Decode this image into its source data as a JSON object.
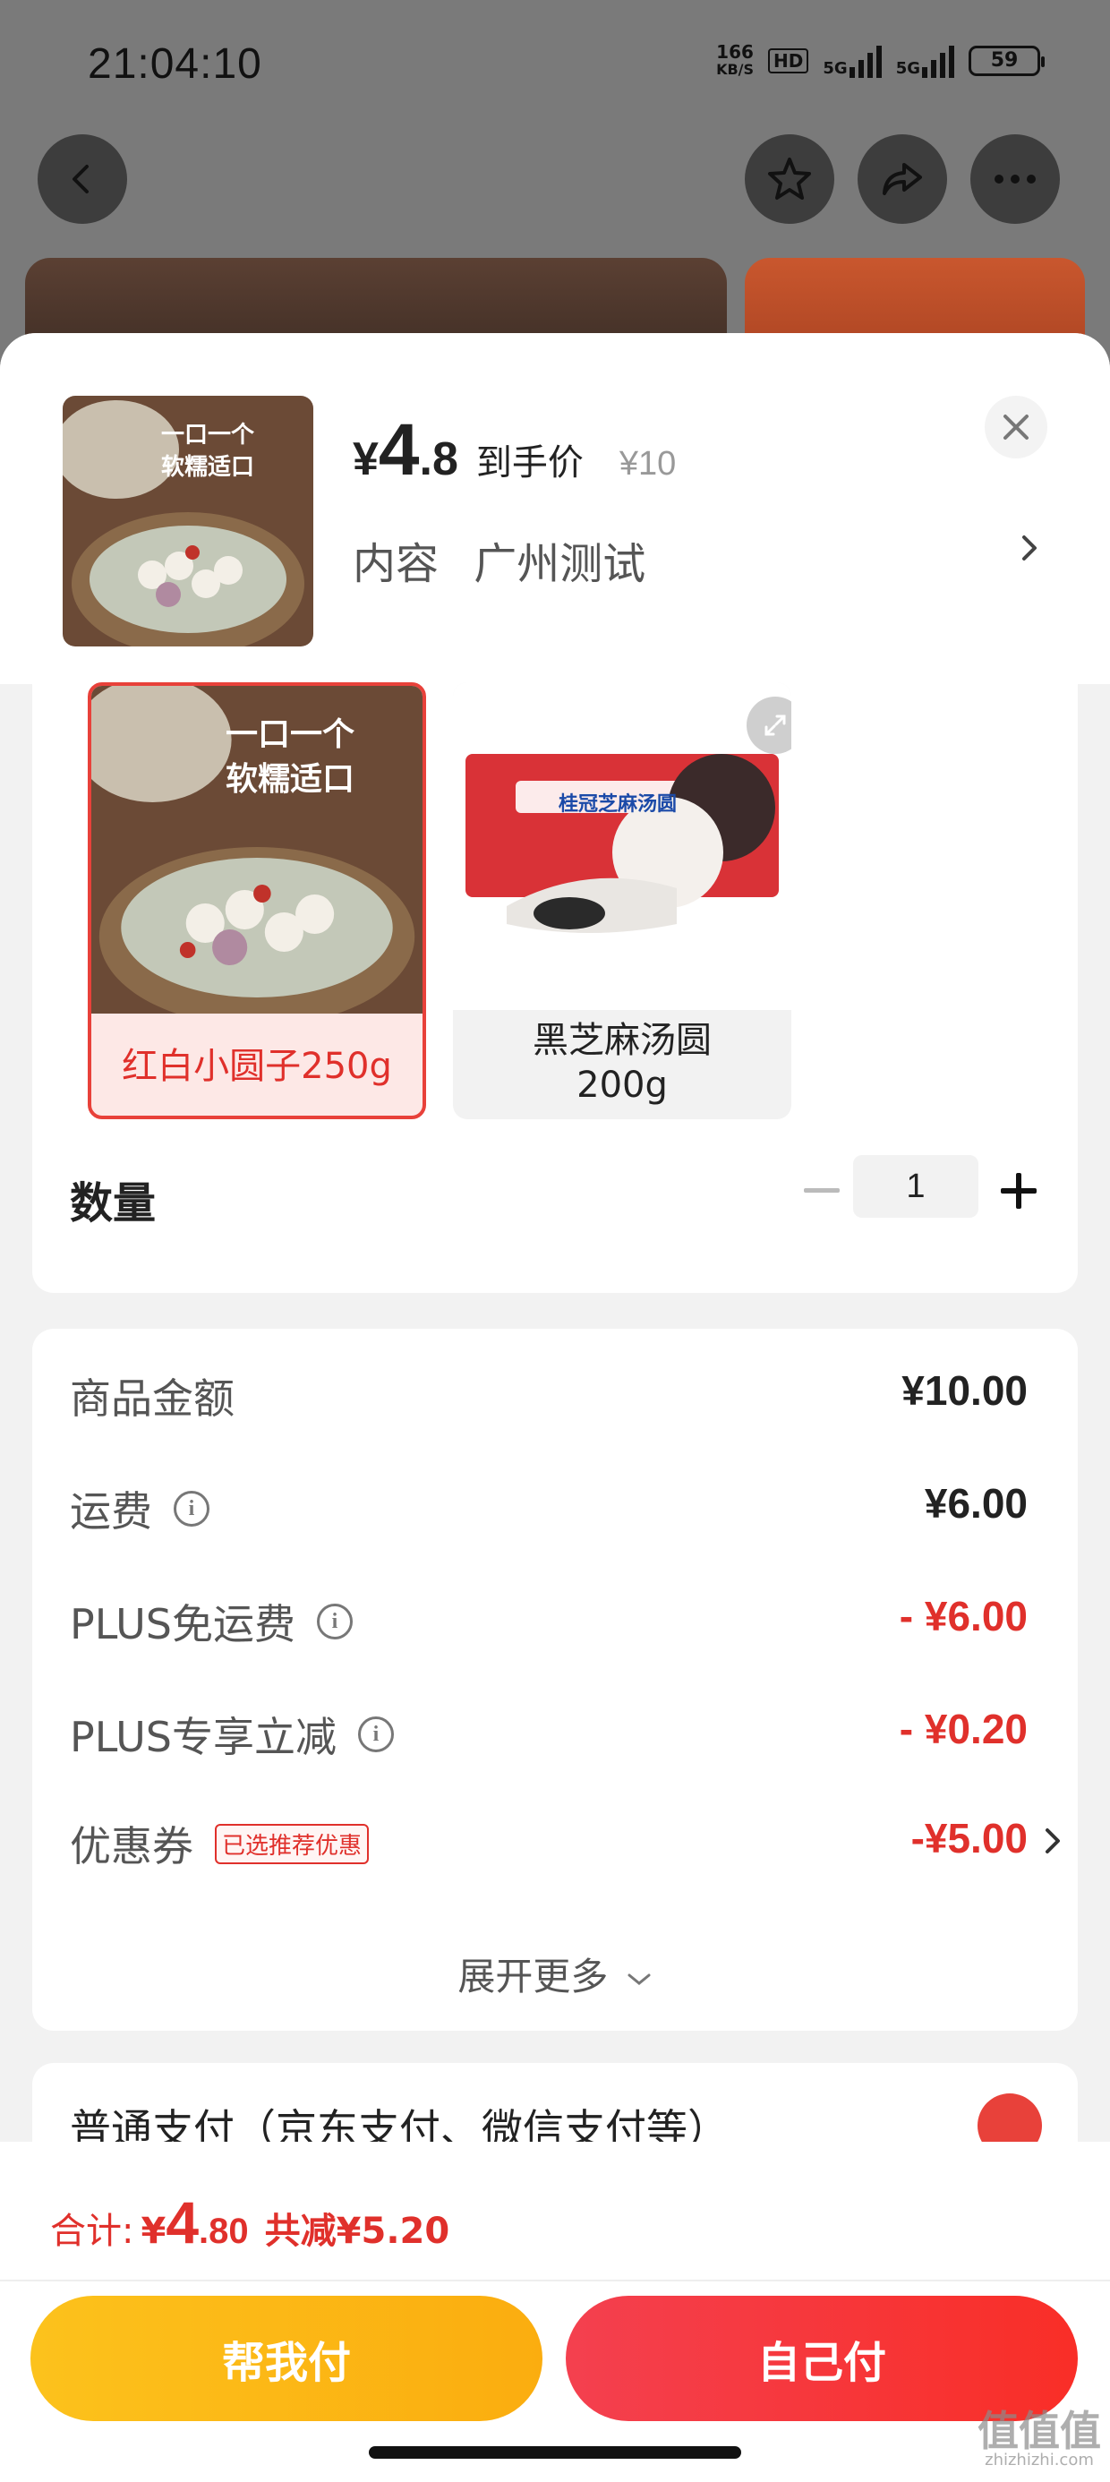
{
  "status_bar": {
    "time": "21:04:10",
    "net_speed_value": "166",
    "net_speed_unit": "KB/S",
    "hd_label": "HD",
    "signal1_label": "5G",
    "signal2_label": "5G",
    "battery": "59"
  },
  "sheet": {
    "price": {
      "currency": "¥",
      "integer": "4",
      "decimal": ".8",
      "tag": "到手价",
      "original": "¥10"
    },
    "spec": {
      "label": "内容",
      "value": "广州测试"
    },
    "product_image_text": {
      "line1": "一口一个",
      "line2": "软糯适口"
    }
  },
  "variants": [
    {
      "label": "红白小圆子250g",
      "selected": true
    },
    {
      "label": "黑芝麻汤圆\n200g",
      "selected": false,
      "pack_text": "桂冠芝麻汤圆"
    }
  ],
  "quantity": {
    "label": "数量",
    "value": "1"
  },
  "summary": {
    "rows": [
      {
        "label": "商品金额",
        "value": "¥10.00"
      },
      {
        "label": "运费",
        "value": "¥6.00"
      },
      {
        "label": "PLUS免运费",
        "value": "- ¥6.00"
      },
      {
        "label": "PLUS专享立减",
        "value": "- ¥0.20"
      },
      {
        "label": "优惠券",
        "badge": "已选推荐优惠",
        "value": "-¥5.00"
      }
    ],
    "expand_more": "展开更多"
  },
  "payment": {
    "method_label": "普通支付（京东支付、微信支付等）"
  },
  "footer": {
    "total_label": "合计:",
    "total_currency": "¥",
    "total_integer": "4",
    "total_decimal": ".80",
    "total_saved": "共减¥5.20",
    "help_pay_button": "帮我付",
    "self_pay_button": "自己付"
  },
  "watermark": {
    "main": "值值值",
    "sub": "zhizhizhi.com"
  },
  "colors": {
    "accent_red": "#e0302b",
    "button_yellow": "#fcc21c",
    "button_red": "#f4404f"
  }
}
